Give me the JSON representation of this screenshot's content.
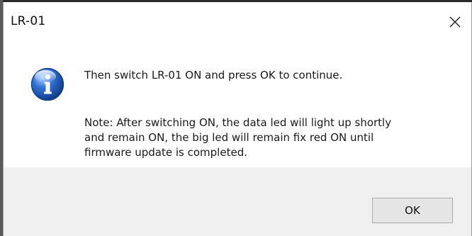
{
  "window": {
    "title": "LR-01",
    "close_icon": "close-icon"
  },
  "message": {
    "icon": "info-icon",
    "main": "Then switch LR-01 ON and press OK to continue.",
    "note_lines": [
      "Note: After switching ON, the data led will light up shortly",
      "and remain ON, the big led will remain fix red ON until",
      "firmware update is completed."
    ]
  },
  "buttons": {
    "ok_label": "OK"
  },
  "colors": {
    "footer_bg": "#f0f0f0",
    "icon_blue": "#1f5fbf",
    "button_bg": "#e5e5e5",
    "button_border": "#adadad"
  }
}
